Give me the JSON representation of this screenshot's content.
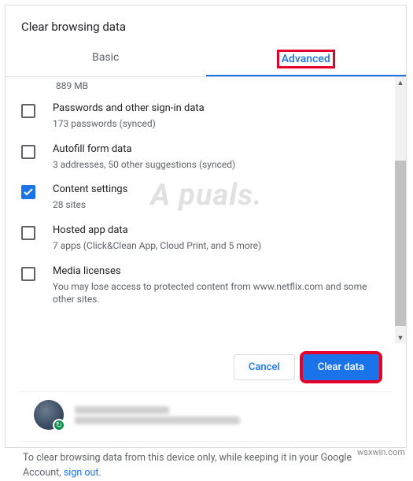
{
  "dialog": {
    "title": "Clear browsing data",
    "tabs": {
      "basic": "Basic",
      "advanced": "Advanced"
    },
    "truncated_top": "889 MB",
    "items": [
      {
        "checked": false,
        "label": "Passwords and other sign-in data",
        "sub": "173 passwords (synced)"
      },
      {
        "checked": false,
        "label": "Autofill form data",
        "sub": "3 addresses, 50 other suggestions (synced)"
      },
      {
        "checked": true,
        "label": "Content settings",
        "sub": "28 sites"
      },
      {
        "checked": false,
        "label": "Hosted app data",
        "sub": "7 apps (Click&Clean App, Cloud Print, and 5 more)"
      },
      {
        "checked": false,
        "label": "Media licenses",
        "sub": "You may lose access to protected content from www.netflix.com and some other sites."
      }
    ],
    "buttons": {
      "cancel": "Cancel",
      "clear": "Clear data"
    },
    "footer": {
      "text_prefix": "To clear browsing data from this device only, while keeping it in your Google Account, ",
      "link": "sign out",
      "text_suffix": "."
    }
  },
  "watermark": "A puals.",
  "source": "wsxwin.com"
}
